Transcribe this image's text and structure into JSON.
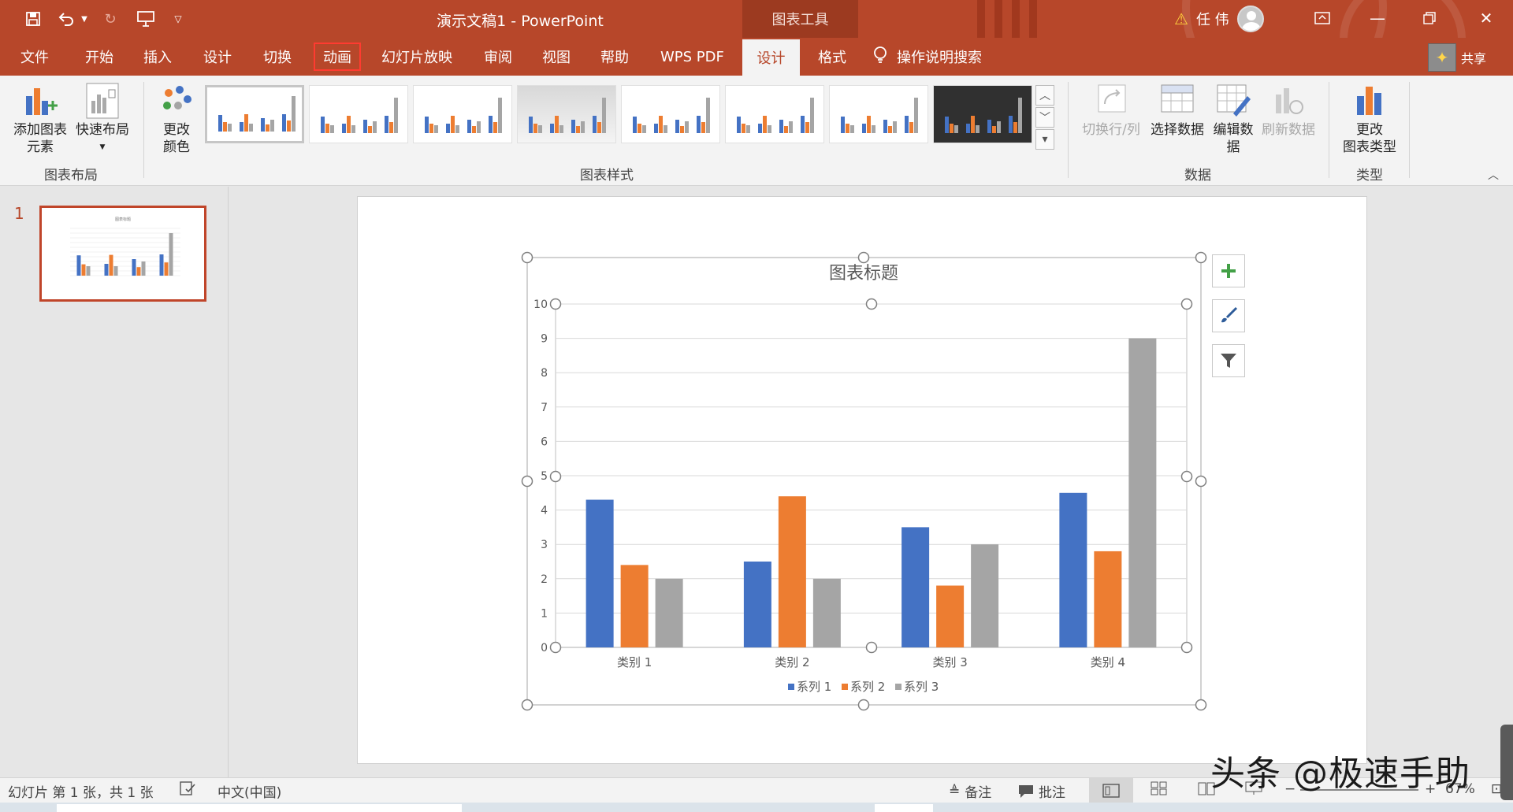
{
  "titlebar": {
    "doc_title": "演示文稿1  -  PowerPoint",
    "context_tool": "图表工具",
    "user_name": "任 伟"
  },
  "tabs": [
    "文件",
    "开始",
    "插入",
    "设计",
    "切换",
    "动画",
    "幻灯片放映",
    "审阅",
    "视图",
    "帮助",
    "WPS PDF",
    "设计",
    "格式"
  ],
  "tab_search": "操作说明搜索",
  "share_label": "共享",
  "ribbon": {
    "add_element": [
      "添加图表",
      "元素"
    ],
    "quick_layout": "快速布局",
    "change_color": [
      "更改",
      "颜色"
    ],
    "layout_group": "图表布局",
    "styles_group": "图表样式",
    "switch_row_col": "切换行/列",
    "select_data": "选择数据",
    "edit_data": [
      "编辑数",
      "据"
    ],
    "refresh_data": "刷新数据",
    "data_group": "数据",
    "change_type": [
      "更改",
      "图表类型"
    ],
    "type_group": "类型"
  },
  "thumbnail": {
    "slide_number": "1"
  },
  "chart_data": {
    "type": "bar",
    "title": "图表标题",
    "categories": [
      "类别 1",
      "类别 2",
      "类别 3",
      "类别 4"
    ],
    "series": [
      {
        "name": "系列 1",
        "values": [
          4.3,
          2.5,
          3.5,
          4.5
        ]
      },
      {
        "name": "系列 2",
        "values": [
          2.4,
          4.4,
          1.8,
          2.8
        ]
      },
      {
        "name": "系列 3",
        "values": [
          2,
          2,
          3,
          9
        ]
      }
    ],
    "ylim": [
      0,
      10
    ],
    "yticks": [
      "0",
      "1",
      "2",
      "3",
      "4",
      "5",
      "6",
      "7",
      "8",
      "9",
      "10"
    ],
    "grid": true,
    "legend": "bottom",
    "colors": [
      "#4472c4",
      "#ed7d31",
      "#a5a5a5"
    ]
  },
  "statusbar": {
    "slide_info": "幻灯片 第 1 张，共 1 张",
    "language": "中文(中国)",
    "notes": "备注",
    "comments": "批注",
    "zoom": "67%"
  },
  "watermark": "头条 @极速手助",
  "colors": {
    "accent": "#b7472a"
  }
}
